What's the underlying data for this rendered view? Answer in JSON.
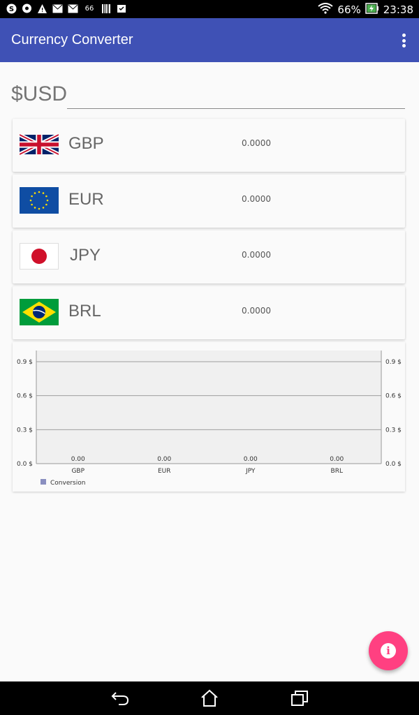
{
  "status_bar": {
    "battery_percent": "66%",
    "time": "23:38",
    "left_icons": [
      "skype-icon",
      "chat-icon",
      "warning-icon",
      "mail-icon",
      "mail-icon",
      "signal-66-icon",
      "barcode-icon",
      "clipboard-icon"
    ],
    "signal_label": "66"
  },
  "app_bar": {
    "title": "Currency Converter"
  },
  "usd_input": {
    "label": "$USD",
    "value": "",
    "placeholder": ""
  },
  "currencies": [
    {
      "code": "GBP",
      "value": "0.0000",
      "flag": "uk-flag"
    },
    {
      "code": "EUR",
      "value": "0.0000",
      "flag": "eu-flag"
    },
    {
      "code": "JPY",
      "value": "0.0000",
      "flag": "japan-flag"
    },
    {
      "code": "BRL",
      "value": "0.0000",
      "flag": "brazil-flag"
    }
  ],
  "chart_data": {
    "type": "bar",
    "categories": [
      "GBP",
      "EUR",
      "JPY",
      "BRL"
    ],
    "series": [
      {
        "name": "Conversion",
        "values": [
          0.0,
          0.0,
          0.0,
          0.0
        ]
      }
    ],
    "value_labels": [
      "0.00",
      "0.00",
      "0.00",
      "0.00"
    ],
    "yticks": [
      "0.0 $",
      "0.3 $",
      "0.6 $",
      "0.9 $"
    ],
    "ylim": [
      0,
      0.9
    ],
    "legend": "bottom-left",
    "grid": true,
    "series_color": "#8a8fc0"
  },
  "colors": {
    "primary": "#3f51b5",
    "accent": "#ff4081"
  }
}
